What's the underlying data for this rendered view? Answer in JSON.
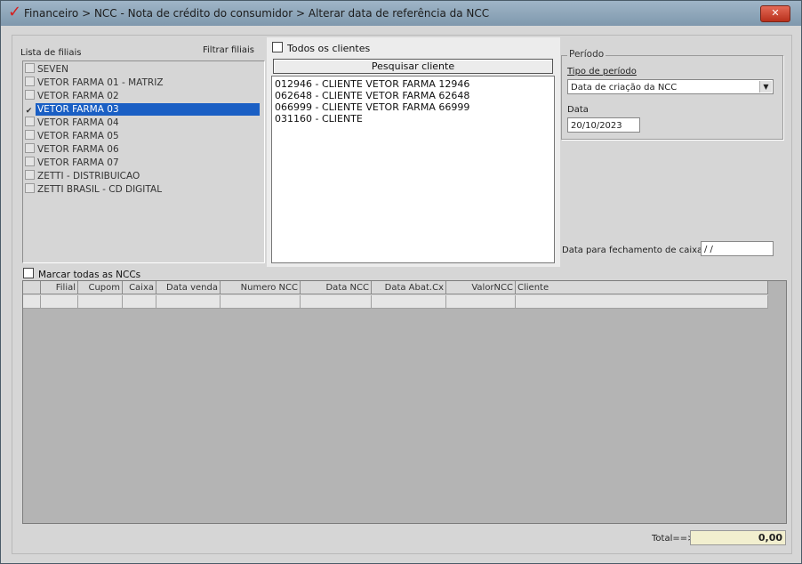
{
  "window": {
    "title": "Financeiro > NCC - Nota de crédito do consumidor > Alterar data de referência da NCC",
    "close_label": "✕"
  },
  "filiais": {
    "label": "Lista de filiais",
    "filter_button": "Filtrar filiais",
    "items": [
      {
        "label": "SEVEN",
        "checked": false
      },
      {
        "label": "VETOR FARMA 01 - MATRIZ",
        "checked": false
      },
      {
        "label": "VETOR FARMA 02",
        "checked": false
      },
      {
        "label": "VETOR FARMA 03",
        "checked": true
      },
      {
        "label": "VETOR FARMA 04",
        "checked": false
      },
      {
        "label": "VETOR FARMA 05",
        "checked": false
      },
      {
        "label": "VETOR FARMA 06",
        "checked": false
      },
      {
        "label": "VETOR FARMA 07",
        "checked": false
      },
      {
        "label": "ZETTI - DISTRIBUICAO",
        "checked": false
      },
      {
        "label": "ZETTI BRASIL - CD DIGITAL",
        "checked": false
      }
    ]
  },
  "clientes": {
    "todos_label": "Todos os clientes",
    "search_button": "Pesquisar cliente",
    "items": [
      "012946 - CLIENTE VETOR FARMA 12946",
      "062648 - CLIENTE VETOR FARMA 62648",
      "066999 - CLIENTE VETOR FARMA 66999",
      "031160 - CLIENTE"
    ]
  },
  "periodo": {
    "title": "Período",
    "tipo_label": "Tipo de período",
    "tipo_value": "Data de criação da NCC",
    "data_label": "Data",
    "data_value": "20/10/2023"
  },
  "fechamento": {
    "label": "Data para fechamento de caixa",
    "value": " / /"
  },
  "grid": {
    "mark_all_label": "Marcar todas as NCCs",
    "columns": [
      "",
      "Filial",
      "Cupom",
      "Caixa",
      "Data venda",
      "Numero NCC",
      "Data NCC",
      "Data Abat.Cx",
      "ValorNCC",
      "Cliente"
    ]
  },
  "total": {
    "label": "Total==>",
    "value": "0,00"
  }
}
